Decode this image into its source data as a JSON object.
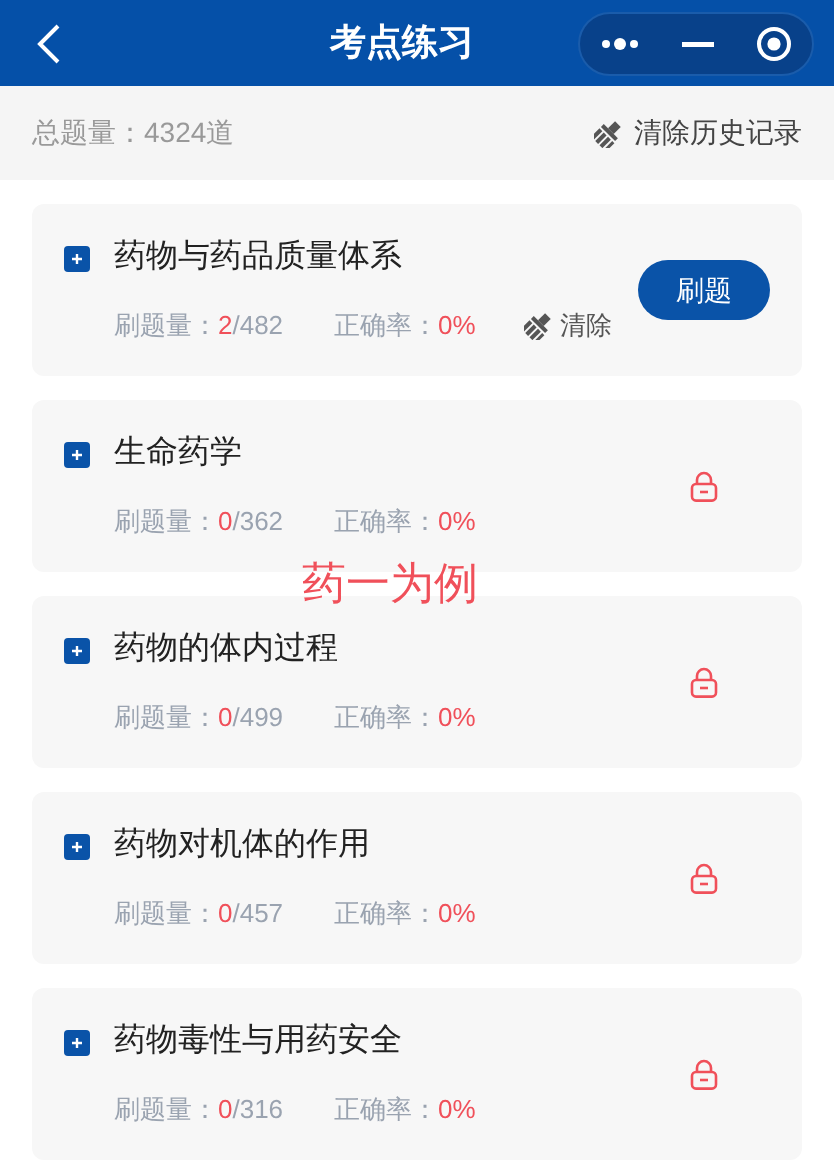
{
  "header": {
    "title": "考点练习"
  },
  "summary": {
    "total": "总题量：4324道",
    "clear_all": "清除历史记录"
  },
  "annotation": "药一为例",
  "subjects": [
    {
      "title": "药物与药品质量体系",
      "kind": "unlocked",
      "count_label": "刷题量：",
      "done": "2",
      "total": "/482",
      "rate_label": "正确率：",
      "rate": "0%",
      "clear": "清除",
      "action": "刷题"
    },
    {
      "title": "生命药学",
      "kind": "locked",
      "count_label": "刷题量：",
      "done": "0",
      "total": "/362",
      "rate_label": "正确率：",
      "rate": "0%"
    },
    {
      "title": "药物的体内过程",
      "kind": "locked",
      "count_label": "刷题量：",
      "done": "0",
      "total": "/499",
      "rate_label": "正确率：",
      "rate": "0%"
    },
    {
      "title": "药物对机体的作用",
      "kind": "locked",
      "count_label": "刷题量：",
      "done": "0",
      "total": "/457",
      "rate_label": "正确率：",
      "rate": "0%"
    },
    {
      "title": "药物毒性与用药安全",
      "kind": "locked",
      "count_label": "刷题量：",
      "done": "0",
      "total": "/316",
      "rate_label": "正确率：",
      "rate": "0%"
    }
  ]
}
